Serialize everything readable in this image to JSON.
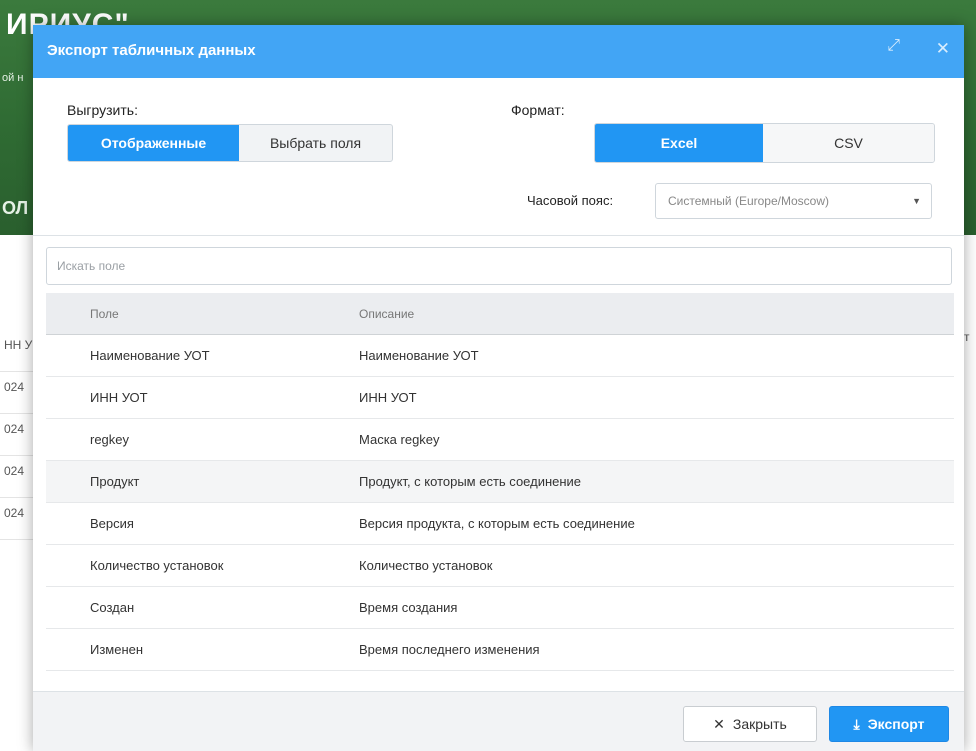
{
  "background": {
    "title": "ИРИУС\"",
    "subtitle": "ой н",
    "section": "ОЛ",
    "left_col_header": "НН У",
    "left_col_values": [
      "024",
      "024",
      "024",
      "024"
    ],
    "right_col_header": "ст"
  },
  "modal": {
    "title": "Экспорт табличных данных",
    "expand_icon": "expand-icon",
    "close_icon": "close-icon",
    "export_label": "Выгрузить:",
    "export_options": [
      "Отображенные",
      "Выбрать поля"
    ],
    "export_selected": "Отображенные",
    "format_label": "Формат:",
    "format_options": [
      "Excel",
      "CSV"
    ],
    "format_selected": "Excel",
    "timezone_label": "Часовой пояс:",
    "timezone_value": "Системный (Europe/Moscow)",
    "search_placeholder": "Искать поле",
    "table": {
      "headers": [
        "Поле",
        "Описание"
      ],
      "rows": [
        [
          "Наименование УОТ",
          "Наименование УОТ"
        ],
        [
          "ИНН УОТ",
          "ИНН УОТ"
        ],
        [
          "regkey",
          "Маска regkey"
        ],
        [
          "Продукт",
          "Продукт, с которым есть соединение"
        ],
        [
          "Версия",
          "Версия продукта, с которым есть соединение"
        ],
        [
          "Количество установок",
          "Количество установок"
        ],
        [
          "Создан",
          "Время создания"
        ],
        [
          "Изменен",
          "Время последнего изменения"
        ]
      ]
    },
    "buttons": {
      "close_label": "Закрыть",
      "export_label": "Экспорт"
    },
    "colors": {
      "header": "#42a5f5",
      "accent": "#2196f3"
    }
  }
}
